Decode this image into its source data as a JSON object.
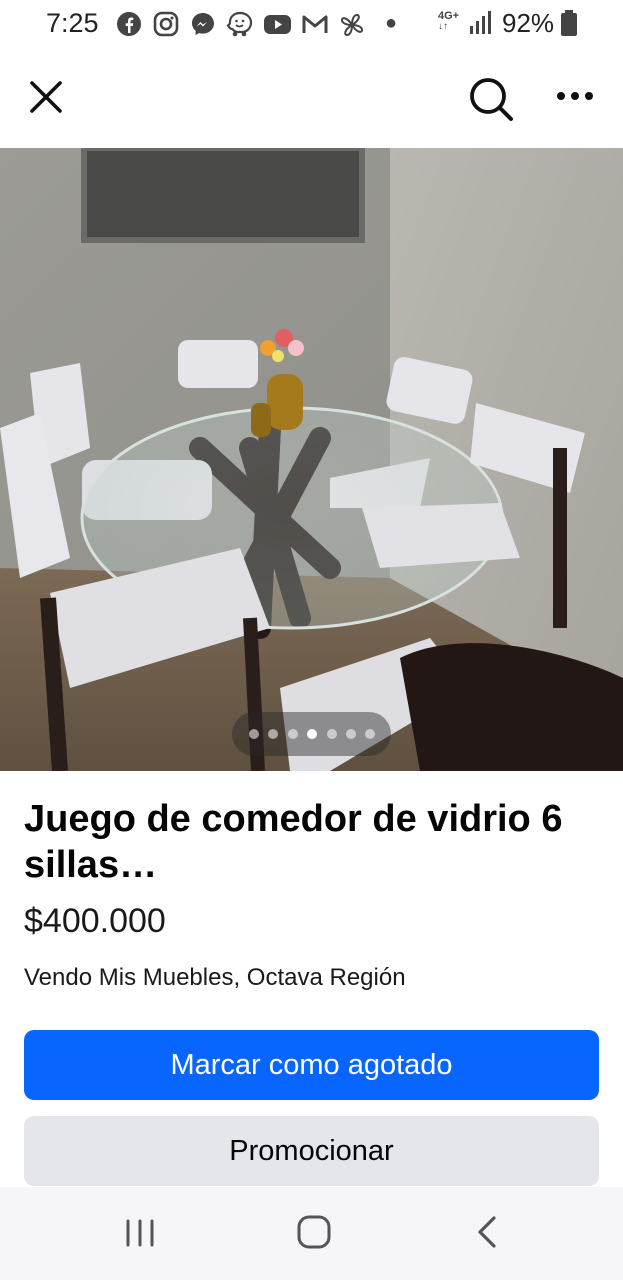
{
  "status_bar": {
    "time": "7:25",
    "network": "4G+",
    "battery": "92%",
    "notification_icons": [
      "facebook-icon",
      "instagram-icon",
      "messenger-icon",
      "waze-icon",
      "youtube-icon",
      "gmail-icon",
      "pinwheel-icon"
    ]
  },
  "listing": {
    "title": "Juego de comedor de vidrio 6 sillas…",
    "price": "$400.000",
    "location": "Vendo Mis Muebles, Octava Región",
    "photo_count": 7,
    "active_photo": 4
  },
  "actions": {
    "mark_sold": "Marcar como agotado",
    "promote": "Promocionar"
  },
  "colors": {
    "primary": "#0866ff",
    "secondary_bg": "#e4e6eb"
  }
}
